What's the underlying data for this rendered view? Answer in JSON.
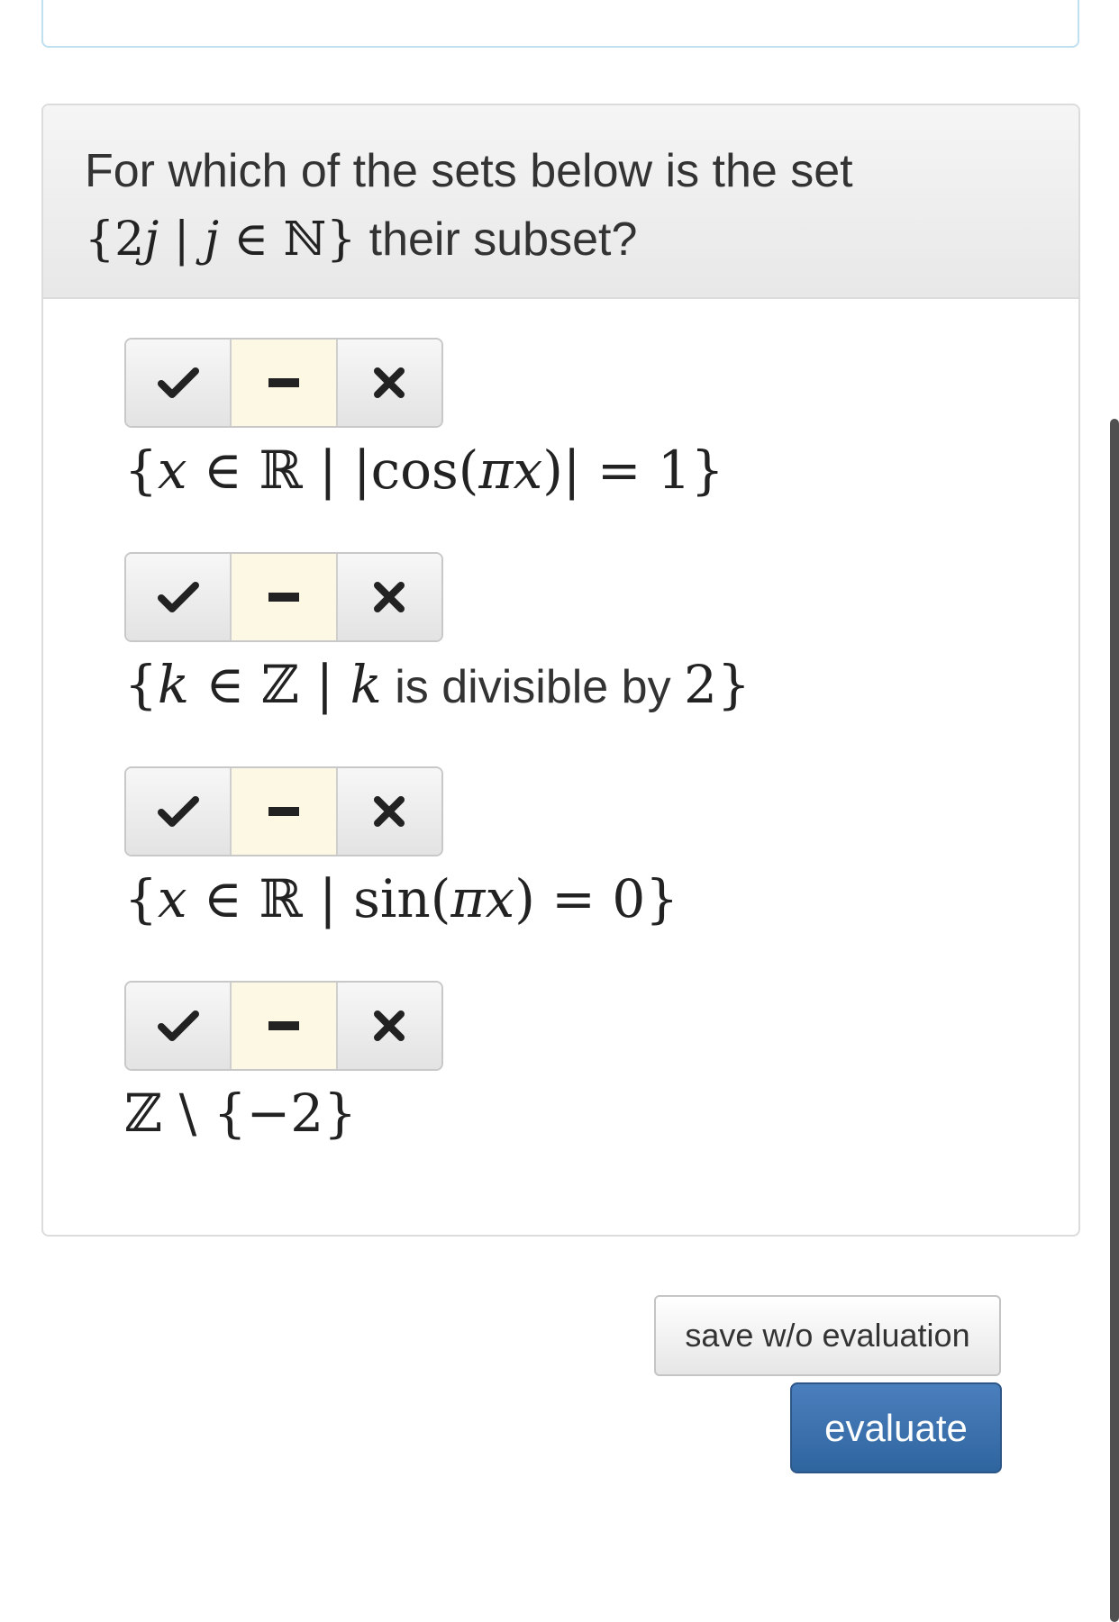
{
  "question": {
    "text_prefix": "For which of the sets below is the set",
    "set_open": "{2",
    "set_var": "j",
    "set_sep": " | ",
    "set_var2": "j",
    "set_in": " ∈ ",
    "set_space": "ℕ",
    "set_close": "}",
    "text_suffix": " their subset?"
  },
  "options": [
    {
      "math_parts": [
        "{",
        "x",
        " ∈ ",
        "ℝ",
        " | |",
        "cos",
        "(",
        "πx",
        ")| = 1}"
      ]
    },
    {
      "math_parts": [
        "{",
        "k",
        " ∈ ",
        "ℤ",
        " | ",
        "k",
        " is divisible by ",
        "2",
        "}"
      ]
    },
    {
      "math_parts": [
        "{",
        "x",
        " ∈ ",
        "ℝ",
        " | ",
        "sin",
        "(",
        "πx",
        ") = 0}"
      ]
    },
    {
      "math_parts": [
        "ℤ",
        " \\ {−2}"
      ]
    }
  ],
  "toggles": {
    "yes_icon": "check-icon",
    "neutral_icon": "dash-icon",
    "no_icon": "cross-icon",
    "active_state": "neutral"
  },
  "actions": {
    "save_label": "save w/o evaluation",
    "evaluate_label": "evaluate"
  },
  "colors": {
    "neutral_active": "#fcf8e3",
    "evaluate_bg": "#3a6ea8",
    "panel_border": "#dcdcdc",
    "top_panel_border": "#bfe0ee"
  }
}
